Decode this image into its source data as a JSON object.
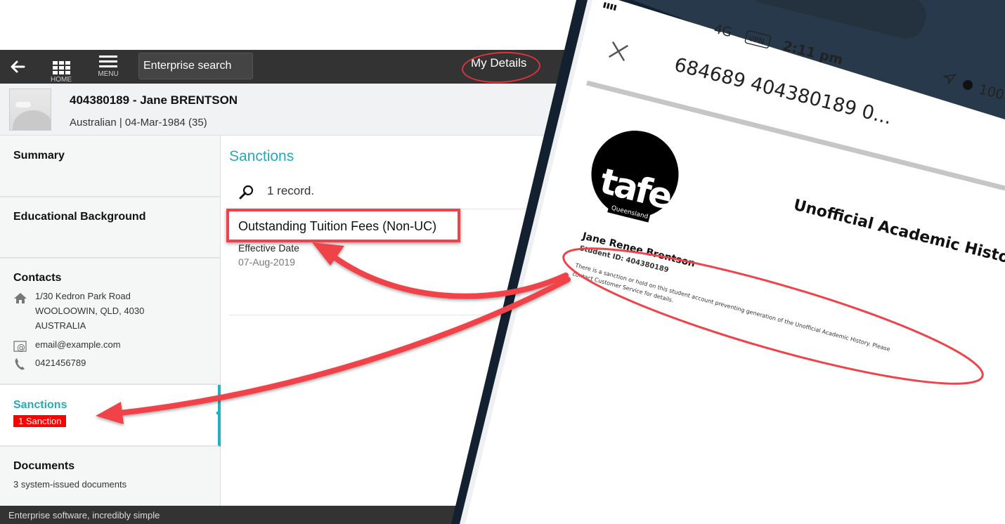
{
  "app": {
    "topbar": {
      "back_icon": "arrow-left-icon",
      "home_label": "HOME",
      "menu_label": "MENU",
      "search_placeholder": "Enterprise search",
      "my_details_label": "My Details"
    },
    "profile": {
      "name": "404380189 - Jane BRENTSON",
      "subtitle": "Australian | 04-Mar-1984 (35)"
    },
    "sidebar": {
      "summary": "Summary",
      "educational_background": "Educational Background",
      "contacts": {
        "title": "Contacts",
        "address_line1": "1/30 Kedron Park Road",
        "address_line2": "WOOLOOWIN, QLD, 4030",
        "address_line3": "AUSTRALIA",
        "email": "email@example.com",
        "phone": "0421456789"
      },
      "sanctions": {
        "title": "Sanctions",
        "badge": "1 Sanction"
      },
      "documents": {
        "title": "Documents",
        "subtitle": "3 system-issued documents"
      }
    },
    "content": {
      "title": "Sanctions",
      "record_count": "1 record.",
      "records": [
        {
          "title": "Outstanding Tuition Fees (Non-UC)",
          "field_label": "Effective Date",
          "field_value": "07-Aug-2019"
        }
      ]
    },
    "footer": "Enterprise software, incredibly simple"
  },
  "phone": {
    "status": {
      "network": "4G",
      "vpn": "VPN",
      "time": "2:11 pm",
      "battery": "100"
    },
    "header_title": "684689 404380189 0...",
    "document": {
      "logo_text": "tafe",
      "logo_sub": "Queensland",
      "heading": "Unofficial Academic History",
      "student_name": "Jane Renee Brentson",
      "student_id": "Student ID: 404380189",
      "notice_line1": "There is a sanction or hold on this student account preventing generation of the Unofficial Academic History. Please",
      "notice_line2": "contact Customer Service for details."
    }
  },
  "annotation_color": "#f0424a"
}
